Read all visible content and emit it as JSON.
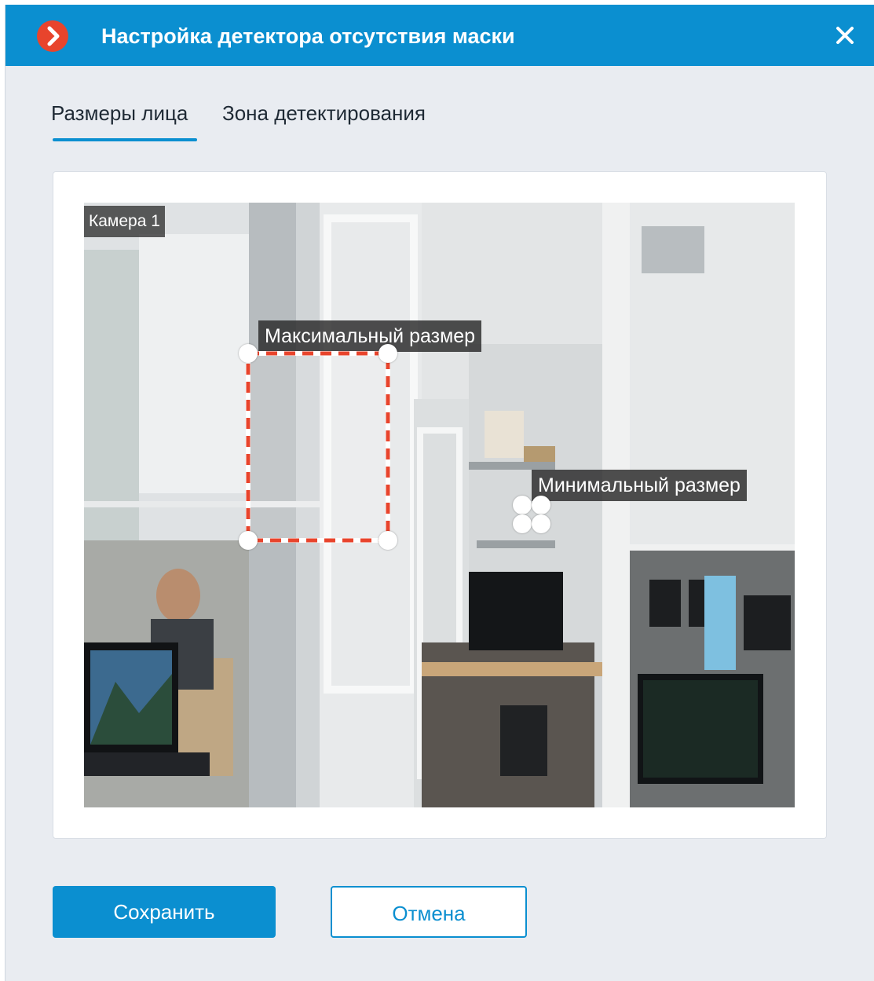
{
  "dialog": {
    "title": "Настройка детектора отсутствия маски",
    "logo_icon": "chevron-right-logo-icon",
    "close_icon": "close-icon",
    "colors": {
      "header": "#0b8fd0",
      "accent": "#0b8fd0",
      "logo": "#e8442c",
      "max_box_dash": "#e8442c"
    }
  },
  "tabs": [
    {
      "label": "Размеры лица",
      "active": true
    },
    {
      "label": "Зона детектирования",
      "active": false
    }
  ],
  "preview": {
    "camera_label": "Камера 1",
    "max_size_label": "Максимальный размер",
    "min_size_label": "Минимальный размер"
  },
  "buttons": {
    "save_label": "Сохранить",
    "cancel_label": "Отмена"
  }
}
